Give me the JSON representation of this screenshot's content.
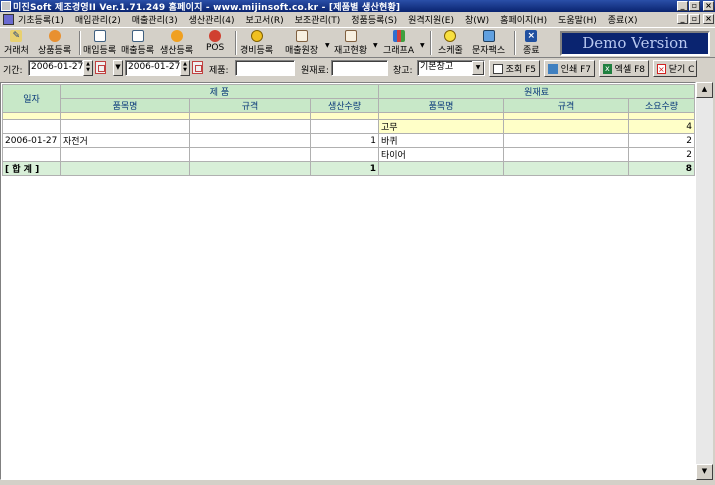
{
  "window": {
    "title": "미진Soft 제조경영II Ver.1.71.249          홈페이지 - www.mijinsoft.co.kr - [제품별 생산현황]"
  },
  "menu": [
    "기초등록(1)",
    "매입관리(2)",
    "매출관리(3)",
    "생산관리(4)",
    "보고서(R)",
    "보조관리(T)",
    "정품등록(S)",
    "원격지원(E)",
    "창(W)",
    "홈페이지(H)",
    "도움말(H)",
    "종료(X)"
  ],
  "toolbar": {
    "buttons": [
      {
        "id": "client",
        "label": "거래처",
        "icon": "pencil-icon"
      },
      {
        "id": "product",
        "label": "상품등록",
        "icon": "box-icon"
      },
      {
        "id": "purchase",
        "label": "매입등록",
        "icon": "document-icon"
      },
      {
        "id": "sales",
        "label": "매출등록",
        "icon": "document-icon"
      },
      {
        "id": "production",
        "label": "생산등록",
        "icon": "production-icon"
      },
      {
        "id": "pos",
        "label": "POS",
        "icon": "pos-icon"
      },
      {
        "id": "expense",
        "label": "경비등록",
        "icon": "coin-icon"
      },
      {
        "id": "sales-ledger",
        "label": "매출원장",
        "icon": "ledger-icon"
      },
      {
        "id": "inventory",
        "label": "재고현황",
        "icon": "inventory-icon"
      },
      {
        "id": "graph",
        "label": "그래프A",
        "icon": "chart-icon"
      },
      {
        "id": "schedule",
        "label": "스케줄",
        "icon": "clock-icon"
      },
      {
        "id": "sms",
        "label": "문자팩스",
        "icon": "phone-icon"
      },
      {
        "id": "exit",
        "label": "종료",
        "icon": "close-icon"
      }
    ],
    "demo_label": "Demo Version"
  },
  "filters": {
    "period_label": "기간:",
    "date_from": "2006-01-27",
    "date_to": "2006-01-27",
    "product_label": "제품:",
    "product_value": "",
    "material_label": "원재료:",
    "material_value": "",
    "warehouse_label": "창고:",
    "warehouse_value": "기본창고",
    "search_btn": "조회 F5",
    "print_btn": "인쇄 F7",
    "excel_btn": "엑셀 F8",
    "close_btn": "닫기 C"
  },
  "grid": {
    "col_date": "일자",
    "group_product": "제 품",
    "group_material": "원재료",
    "sub_headers": {
      "p_name": "품목명",
      "p_spec": "규격",
      "p_qty": "생산수량",
      "m_name": "품목명",
      "m_spec": "규격",
      "m_qty": "소요수량"
    },
    "rows": [
      {
        "date": "",
        "p_name": "",
        "p_spec": "",
        "p_qty": "",
        "m_name": "고무",
        "m_spec": "",
        "m_qty": "4"
      },
      {
        "date": "2006-01-27",
        "p_name": "자전거",
        "p_spec": "",
        "p_qty": "1",
        "m_name": "바퀴",
        "m_spec": "",
        "m_qty": "2"
      },
      {
        "date": "",
        "p_name": "",
        "p_spec": "",
        "p_qty": "",
        "m_name": "타이어",
        "m_spec": "",
        "m_qty": "2"
      }
    ],
    "total": {
      "label": "[ 합 계 ]",
      "p_qty": "1",
      "m_qty": "8"
    }
  }
}
